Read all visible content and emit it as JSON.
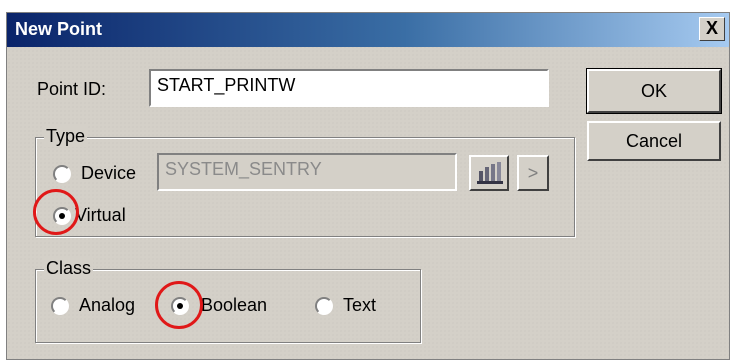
{
  "window": {
    "title": "New Point",
    "close_glyph": "X"
  },
  "point_id": {
    "label": "Point ID:",
    "value": "START_PRINTW"
  },
  "buttons": {
    "ok": "OK",
    "cancel": "Cancel"
  },
  "type_group": {
    "label": "Type",
    "device_label": "Device",
    "device_value": "SYSTEM_SENTRY",
    "virtual_label": "Virtual",
    "selected": "Virtual",
    "arrow_glyph": ">"
  },
  "class_group": {
    "label": "Class",
    "options": [
      "Analog",
      "Boolean",
      "Text"
    ],
    "selected": "Boolean"
  },
  "colors": {
    "title_bar": "#0a246a",
    "highlight_circle": "#e01818",
    "dialog_face": "#d4d0c8"
  }
}
